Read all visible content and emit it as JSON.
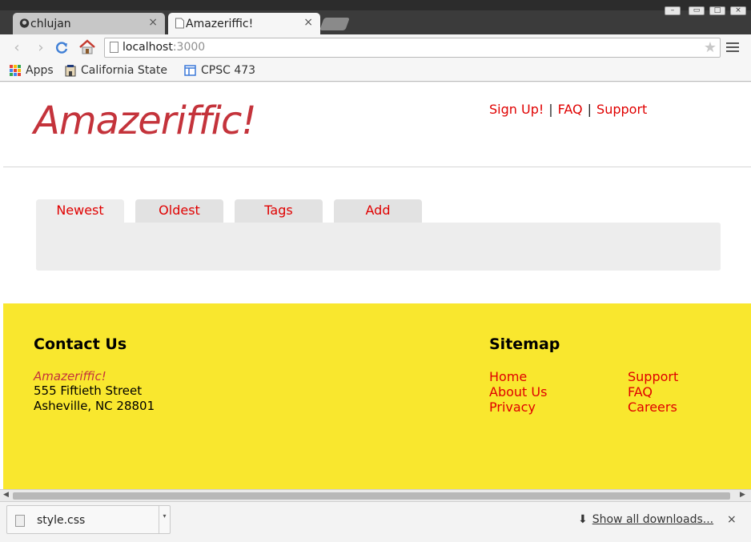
{
  "browser": {
    "tabs": [
      {
        "title": "chlujan",
        "active": false,
        "icon": "github-icon"
      },
      {
        "title": "Amazeriffic!",
        "active": true,
        "icon": "page-icon"
      }
    ],
    "url": {
      "host": "localhost",
      "port": ":3000"
    },
    "bookmarks": [
      {
        "label": "Apps",
        "icon": "apps-grid-icon"
      },
      {
        "label": "California State U",
        "icon": "building-icon"
      },
      {
        "label": "CPSC 473",
        "icon": "window-icon"
      }
    ]
  },
  "page": {
    "logo": "Amazeriffic!",
    "topnav": {
      "signup": "Sign Up!",
      "faq": "FAQ",
      "support": "Support",
      "separator": "|"
    },
    "tabs": [
      {
        "label": "Newest",
        "active": true
      },
      {
        "label": "Oldest",
        "active": false
      },
      {
        "label": "Tags",
        "active": false
      },
      {
        "label": "Add",
        "active": false
      }
    ],
    "footer": {
      "contact": {
        "heading": "Contact Us",
        "company": "Amazeriffic!",
        "street": "555 Fiftieth Street",
        "city": "Asheville, NC 28801"
      },
      "sitemap": {
        "heading": "Sitemap",
        "col1": [
          "Home",
          "About Us",
          "Privacy"
        ],
        "col2": [
          "Support",
          "FAQ",
          "Careers"
        ]
      }
    }
  },
  "downloads": {
    "file": "style.css",
    "show_all": "Show all downloads..."
  },
  "colors": {
    "link": "#e00000",
    "logo": "#c4333b",
    "footer_bg": "#f9e72e"
  }
}
